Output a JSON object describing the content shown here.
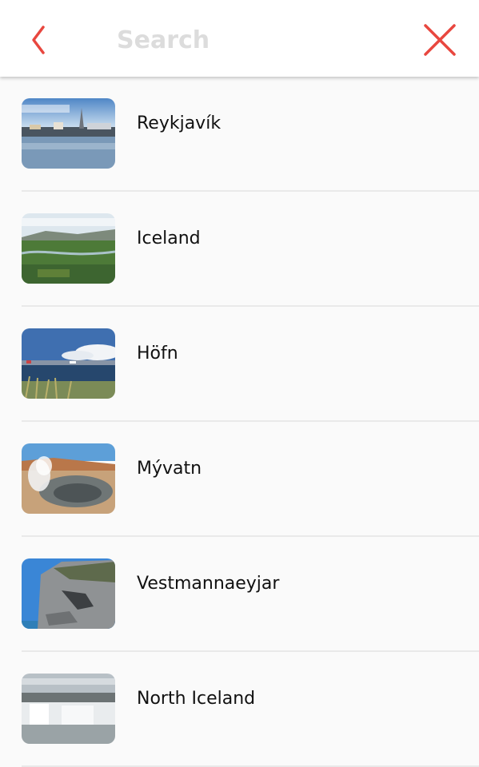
{
  "header": {
    "back_icon": "chevron-left-icon",
    "search_placeholder": "Search",
    "close_icon": "close-icon",
    "accent_color": "#e8473f"
  },
  "destinations": [
    {
      "name": "Reykjavík",
      "thumb": "city-waterfront-photo"
    },
    {
      "name": "Iceland",
      "thumb": "green-valley-photo"
    },
    {
      "name": "Höfn",
      "thumb": "harbor-photo"
    },
    {
      "name": "Mývatn",
      "thumb": "steam-vent-photo"
    },
    {
      "name": "Vestmannaeyjar",
      "thumb": "sea-cliff-photo"
    },
    {
      "name": "North Iceland",
      "thumb": "waterfall-photo"
    }
  ]
}
